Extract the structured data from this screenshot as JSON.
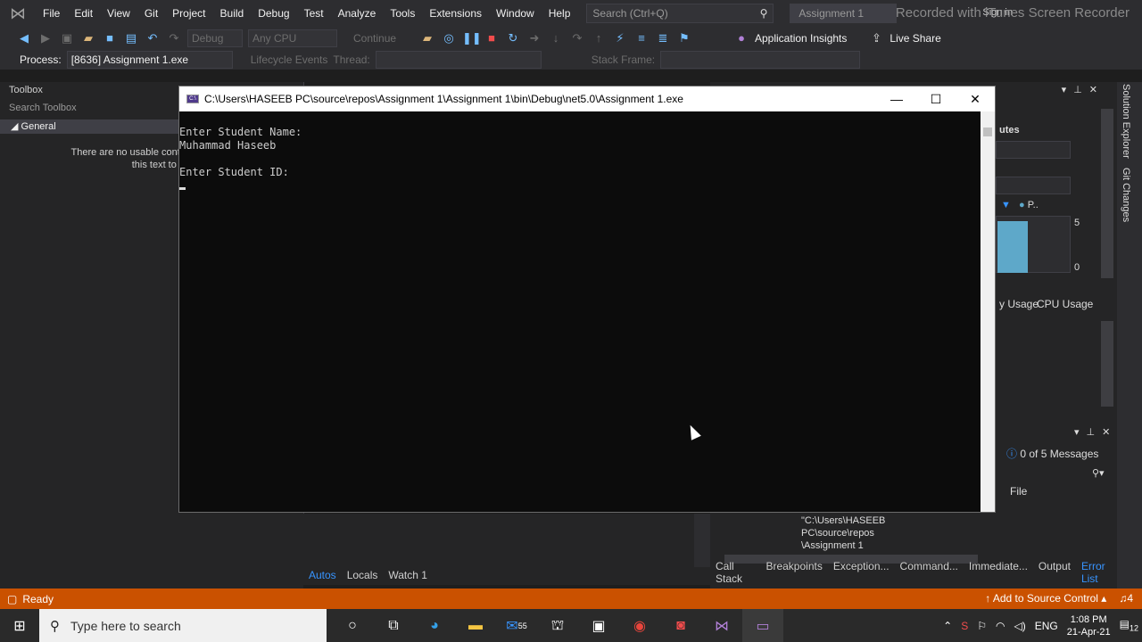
{
  "menubar": {
    "items": [
      "File",
      "Edit",
      "View",
      "Git",
      "Project",
      "Build",
      "Debug",
      "Test",
      "Analyze",
      "Tools",
      "Extensions",
      "Window",
      "Help"
    ],
    "search_placeholder": "Search (Ctrl+Q)",
    "solution_title": "Assignment 1",
    "sign_in": "Sign in",
    "recorder_watermark": "Recorded with iTunes Screen Recorder"
  },
  "toolbar": {
    "config": "Debug",
    "platform": "Any CPU",
    "continue": "Continue",
    "app_insights": "Application Insights",
    "live_share": "Live Share"
  },
  "debug_toolbar": {
    "process_label": "Process:",
    "process_value": "[8636] Assignment 1.exe",
    "lifecycle_events": "Lifecycle Events",
    "thread_label": "Thread:",
    "stack_frame_label": "Stack Frame:"
  },
  "toolbox": {
    "title": "Toolbox",
    "search_placeholder": "Search Toolbox",
    "group": "General",
    "empty_message_line1": "There are no usable controls in this g",
    "empty_message_line2": "this text to add it to th"
  },
  "console": {
    "title": "C:\\Users\\HASEEB PC\\source\\repos\\Assignment 1\\Assignment 1\\bin\\Debug\\net5.0\\Assignment 1.exe",
    "icon_label": "C:\\",
    "lines": [
      "Enter Student Name:",
      "Muhammad Haseeb",
      "",
      "Enter Student ID:"
    ]
  },
  "right_panel": {
    "minutes_label": "utes",
    "scale_top": "5",
    "scale_bottom": "0",
    "legend_label": "P..",
    "memory_tab": "y Usage",
    "cpu_tab": "CPU Usage",
    "messages": "0 of 5 Messages",
    "file_col": "File",
    "path_line1": "\"C:\\Users\\HASEEB",
    "path_line2": "PC\\source\\repos",
    "path_line3": "\\Assignment 1",
    "tabs": [
      "Call Stack",
      "Breakpoints",
      "Exception...",
      "Command...",
      "Immediate...",
      "Output",
      "Error List"
    ],
    "vertical_tabs": [
      "Solution Explorer",
      "Git Changes"
    ]
  },
  "bottom_left_tabs": [
    "Autos",
    "Locals",
    "Watch 1"
  ],
  "statusbar": {
    "status": "Ready",
    "source_control": "Add to Source Control",
    "notifications": "4"
  },
  "taskbar": {
    "search_placeholder": "Type here to search",
    "mail_badge": "55",
    "lang": "ENG",
    "time": "1:08 PM",
    "date": "21-Apr-21",
    "notif_count": "12"
  },
  "colors": {
    "status_bar": "#ca5100",
    "vs_bg": "#2d2d30",
    "console_bg": "#0c0c0c"
  }
}
